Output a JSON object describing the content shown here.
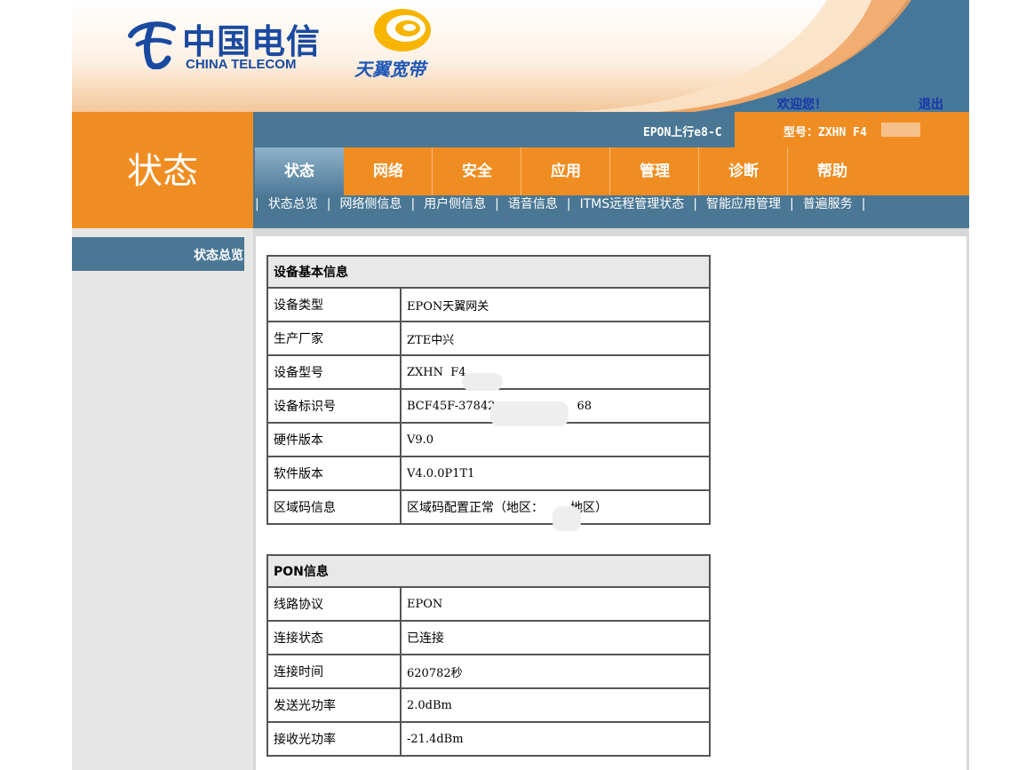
{
  "header": {
    "logo_cn": "中国电信",
    "logo_en": "CHINA TELECOM",
    "broadband_brand": "天翼宽带",
    "welcome": "欢迎您！",
    "logout": "退出",
    "product_line": "EPON上行e8-C",
    "model_label": "型号：ZXHN F4"
  },
  "section_title": "状态",
  "tabs": [
    {
      "label": "状态",
      "active": true
    },
    {
      "label": "网络",
      "active": false
    },
    {
      "label": "安全",
      "active": false
    },
    {
      "label": "应用",
      "active": false
    },
    {
      "label": "管理",
      "active": false
    },
    {
      "label": "诊断",
      "active": false
    },
    {
      "label": "帮助",
      "active": false
    }
  ],
  "subnav": [
    "状态总览",
    "网络侧信息",
    "用户侧信息",
    "语音信息",
    "ITMS远程管理状态",
    "智能应用管理",
    "普遍服务"
  ],
  "sidebar": {
    "items": [
      {
        "label": "状态总览"
      }
    ]
  },
  "device_info": {
    "title": "设备基本信息",
    "rows": [
      {
        "key": "设备类型",
        "value": "EPON天翼网关"
      },
      {
        "key": "生产厂家",
        "value": "ZTE中兴"
      },
      {
        "key": "设备型号",
        "value": "ZXHN  F4"
      },
      {
        "key": "设备标识号",
        "value": "BCF45F-37842",
        "value_suffix": "68"
      },
      {
        "key": "硬件版本",
        "value": "V9.0"
      },
      {
        "key": "软件版本",
        "value": "V4.0.0P1T1"
      },
      {
        "key": "区域码信息",
        "value": "区域码配置正常（地区：",
        "value_suffix": "地区）"
      }
    ]
  },
  "pon_info": {
    "title": "PON信息",
    "rows": [
      {
        "key": "线路协议",
        "value": "EPON"
      },
      {
        "key": "连接状态",
        "value": "已连接"
      },
      {
        "key": "连接时间",
        "value": "620782秒"
      },
      {
        "key": "发送光功率",
        "value": "2.0dBm"
      },
      {
        "key": "接收光功率",
        "value": "-21.4dBm"
      }
    ]
  },
  "colors": {
    "orange": "#f08d22",
    "steel_blue": "#4a7794",
    "link_blue": "#1836a8",
    "brand_blue": "#1a4aa0"
  }
}
